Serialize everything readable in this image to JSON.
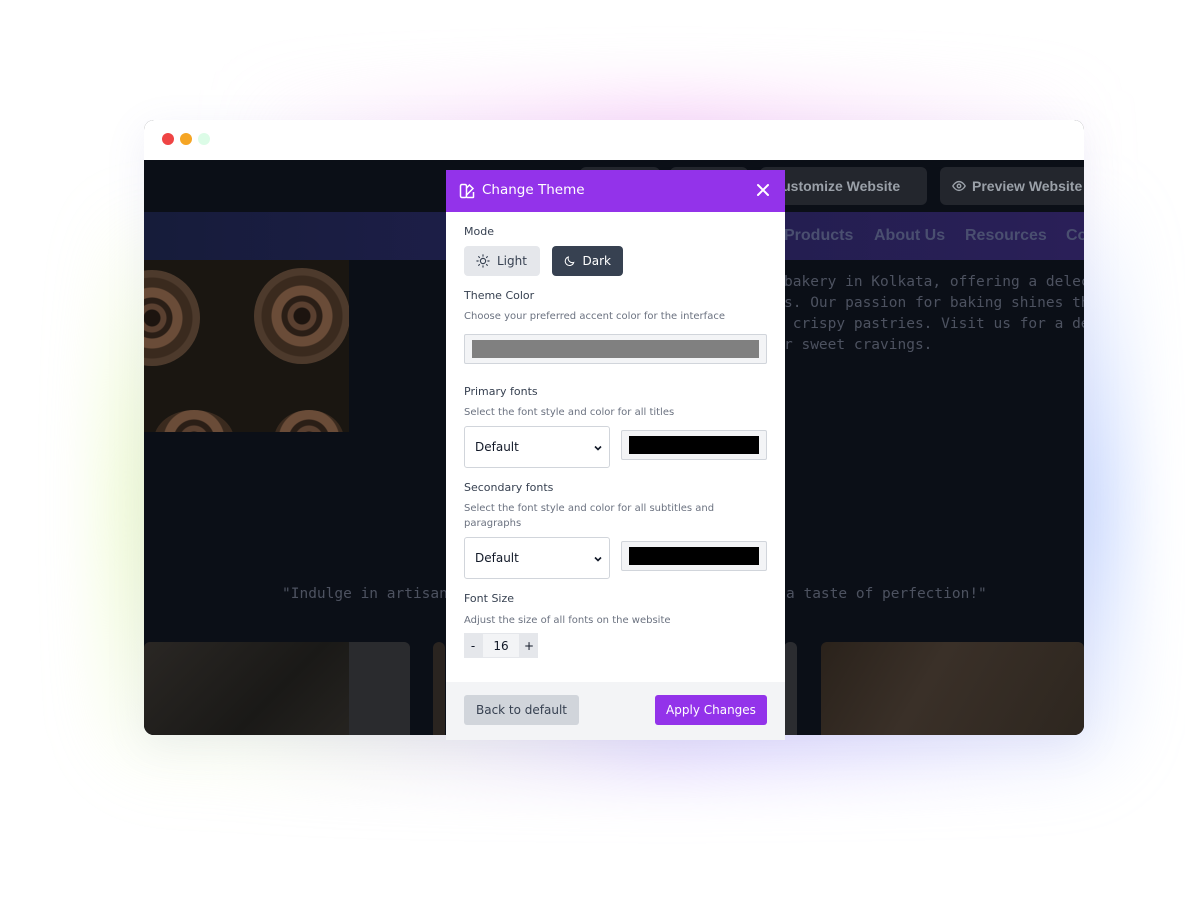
{
  "background_site": {
    "topbar": {
      "customize_label": "Customize Website",
      "preview_label": "Preview Website"
    },
    "nav": [
      "Products",
      "About Us",
      "Resources",
      "Co"
    ],
    "about_text": "bakery in Kolkata, offering a delectable ra\ns. Our passion for baking shines through i\n crispy pastries. Visit us for a delightful e\nr sweet cravings.",
    "quote_left": "\"Indulge in artisanal de",
    "quote_right": "a taste of perfection!\""
  },
  "modal": {
    "title": "Change Theme",
    "mode": {
      "label": "Mode",
      "light_label": "Light",
      "dark_label": "Dark",
      "selected": "Dark"
    },
    "theme_color": {
      "label": "Theme Color",
      "description": "Choose your preferred accent color for the interface",
      "value": "#808080"
    },
    "primary_fonts": {
      "label": "Primary fonts",
      "description": "Select the font style and color for all titles",
      "font_value": "Default",
      "color_value": "#000000"
    },
    "secondary_fonts": {
      "label": "Secondary fonts",
      "description": "Select the font style and color for all subtitles and paragraphs",
      "font_value": "Default",
      "color_value": "#000000"
    },
    "font_size": {
      "label": "Font Size",
      "description": "Adjust the size of all fonts on the website",
      "decrement": "-",
      "value": "16",
      "increment": "+"
    },
    "footer": {
      "default_label": "Back to default",
      "apply_label": "Apply Changes"
    }
  },
  "colors": {
    "accent": "#9333ea",
    "dark_button": "#374151"
  },
  "icons": [
    "palette-icon",
    "close-icon",
    "sun-icon",
    "moon-icon",
    "eye-icon",
    "chevron-down-icon"
  ]
}
